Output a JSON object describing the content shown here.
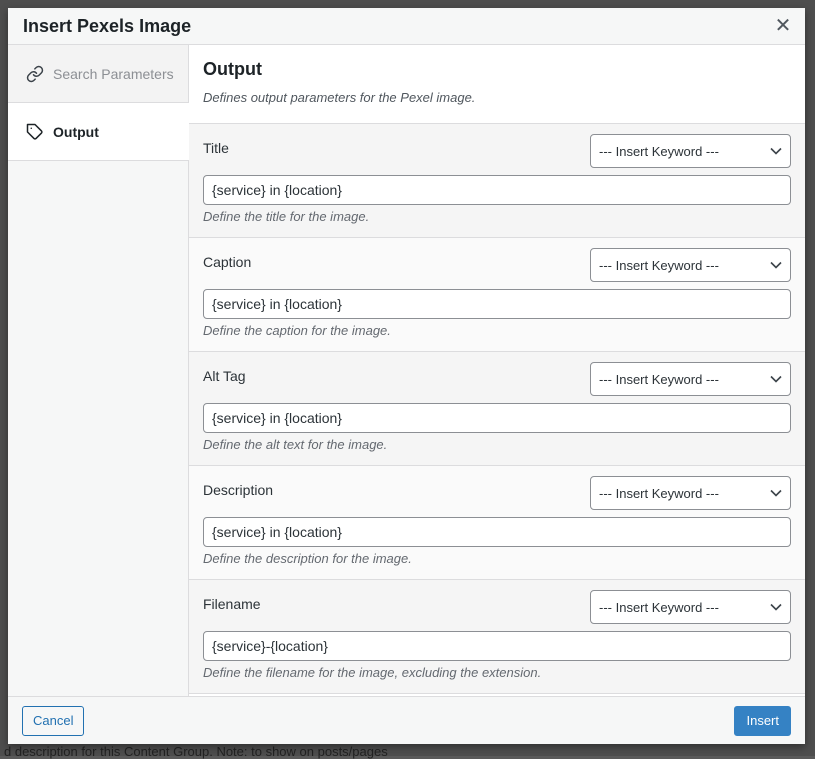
{
  "background": {
    "bottom_text": "d description for this Content Group. Note: to show on posts/pages"
  },
  "modal": {
    "title": "Insert Pexels Image",
    "close_icon": "close-icon",
    "sidebar": {
      "items": [
        {
          "label": "Search Parameters",
          "icon": "link-icon",
          "active": false
        },
        {
          "label": "Output",
          "icon": "tag-icon",
          "active": true
        }
      ]
    },
    "main": {
      "title": "Output",
      "description": "Defines output parameters for the Pexel image.",
      "fields": [
        {
          "label": "Title",
          "keyword_select": "--- Insert Keyword ---",
          "value": "{service} in {location}",
          "help": "Define the title for the image."
        },
        {
          "label": "Caption",
          "keyword_select": "--- Insert Keyword ---",
          "value": "{service} in {location}",
          "help": "Define the caption for the image."
        },
        {
          "label": "Alt Tag",
          "keyword_select": "--- Insert Keyword ---",
          "value": "{service} in {location}",
          "help": "Define the alt text for the image."
        },
        {
          "label": "Description",
          "keyword_select": "--- Insert Keyword ---",
          "value": "{service} in {location}",
          "help": "Define the description for the image."
        },
        {
          "label": "Filename",
          "keyword_select": "--- Insert Keyword ---",
          "value": "{service}-{location}",
          "help": "Define the filename for the image, excluding the extension."
        }
      ]
    },
    "footer": {
      "cancel_label": "Cancel",
      "insert_label": "Insert"
    },
    "colors": {
      "primary": "#2271b1",
      "insert_button": "#3582c4"
    }
  }
}
